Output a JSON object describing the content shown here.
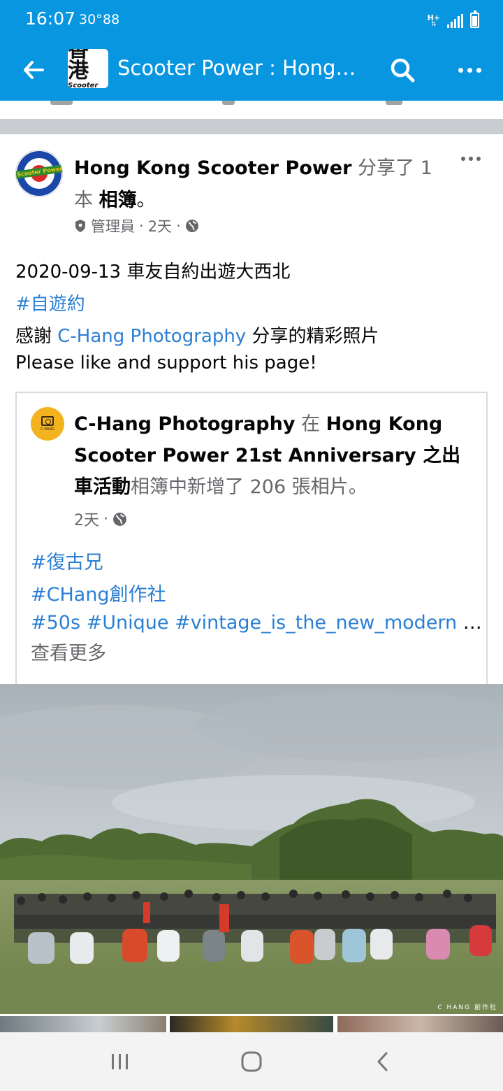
{
  "status_bar": {
    "time": "16:07",
    "temperature": "30°",
    "notification_count": "88",
    "network_type": "H+",
    "background_color": "#0896e1"
  },
  "app_bar": {
    "group_logo_text": "香港",
    "group_logo_subtext": "Scooter Power",
    "title": "Scooter Power : Hong…",
    "icons": [
      "back-arrow-icon",
      "search-icon",
      "more-icon"
    ]
  },
  "post": {
    "author": "Hong Kong Scooter Power",
    "action": " 分享了 1 本 ",
    "object": "相簿",
    "action_end": "。",
    "role": "管理員",
    "separator": "·",
    "time": "2天",
    "lines": {
      "title": "2020-09-13 車友自約出遊大西北",
      "hashtag": "#自遊約",
      "thanks_prefix": "感謝 ",
      "thanks_link": "C-Hang Photography",
      "thanks_suffix": " 分享的精彩照片",
      "support": "Please like and support his page!"
    }
  },
  "shared_post": {
    "author": "C-Hang Photography",
    "connector": " 在 ",
    "album_name": "Hong Kong Scooter Power 21st Anniversary 之出車活動",
    "action": "相簿中新增了 206 張相片。",
    "time": "2天",
    "separator": "·",
    "hashtags": {
      "line1": "#復古兄",
      "line2": "#CHang創作社",
      "line3": "#50s #Unique #vintage_is_the_new_modern",
      "line3_ellipsis": " …"
    },
    "see_more": "查看更多"
  },
  "photo": {
    "watermark": "C HANG 創作社"
  },
  "colors": {
    "brand_blue": "#0896e1",
    "link_blue": "#2a7fd4",
    "secondary_text": "#65676b",
    "separator_grey": "#c9ccd1"
  }
}
